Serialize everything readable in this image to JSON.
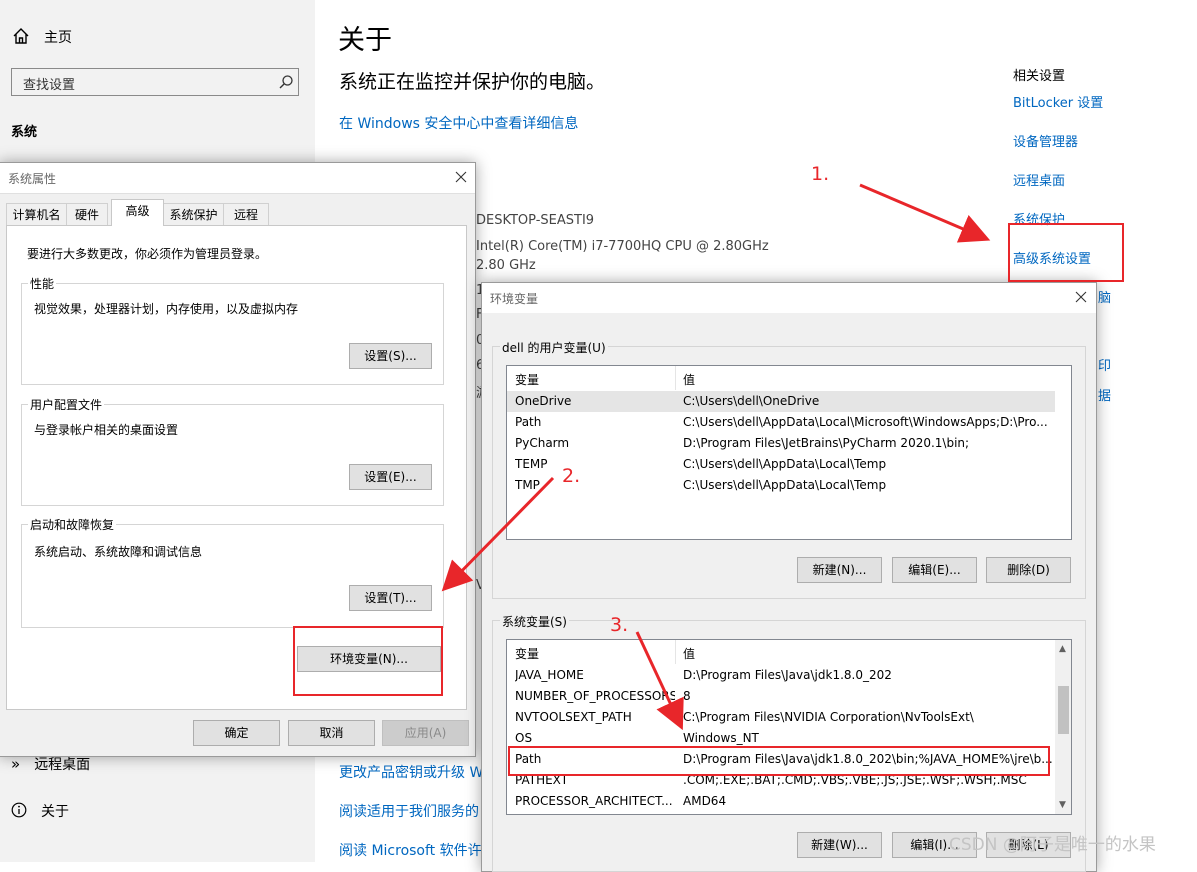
{
  "settings": {
    "nav": {
      "home": "主页",
      "search_placeholder": "查找设置",
      "section": "系统",
      "remote_desktop": "远程桌面",
      "about": "关于"
    },
    "main": {
      "title": "关于",
      "subtitle": "系统正在监控并保护你的电脑。",
      "security_link": "在 Windows 安全中心中查看详细信息",
      "device_name": "DESKTOP-SEASTI9",
      "processor": "Intel(R) Core(TM) i7-7700HQ CPU @ 2.80GHz",
      "processor_speed": "2.80 GHz",
      "partial_chars": [
        "1",
        "F",
        "0",
        "6",
        "游"
      ],
      "partial_v": "V",
      "bottom_links": [
        "更改产品密钥或升级 Wind",
        "阅读适用于我们服务的",
        "阅读 Microsoft 软件许可"
      ]
    },
    "related": {
      "title": "相关设置",
      "links": [
        "BitLocker 设置",
        "设备管理器",
        "远程桌面",
        "系统保护",
        "高级系统设置"
      ],
      "partial_links": [
        "脑",
        "印",
        "据"
      ]
    }
  },
  "system_properties": {
    "title": "系统属性",
    "tabs": [
      "计算机名",
      "硬件",
      "高级",
      "系统保护",
      "远程"
    ],
    "admin_note": "要进行大多数更改，你必须作为管理员登录。",
    "performance": {
      "label": "性能",
      "desc": "视觉效果，处理器计划，内存使用，以及虚拟内存",
      "button": "设置(S)..."
    },
    "user_profiles": {
      "label": "用户配置文件",
      "desc": "与登录帐户相关的桌面设置",
      "button": "设置(E)..."
    },
    "startup": {
      "label": "启动和故障恢复",
      "desc": "系统启动、系统故障和调试信息",
      "button": "设置(T)..."
    },
    "env_button": "环境变量(N)...",
    "ok": "确定",
    "cancel": "取消",
    "apply": "应用(A)"
  },
  "env_vars": {
    "title": "环境变量",
    "user_group": "dell 的用户变量(U)",
    "col_var": "变量",
    "col_val": "值",
    "user_rows": [
      {
        "name": "OneDrive",
        "value": "C:\\Users\\dell\\OneDrive"
      },
      {
        "name": "Path",
        "value": "C:\\Users\\dell\\AppData\\Local\\Microsoft\\WindowsApps;D:\\Pro..."
      },
      {
        "name": "PyCharm",
        "value": "D:\\Program Files\\JetBrains\\PyCharm 2020.1\\bin;"
      },
      {
        "name": "TEMP",
        "value": "C:\\Users\\dell\\AppData\\Local\\Temp"
      },
      {
        "name": "TMP",
        "value": "C:\\Users\\dell\\AppData\\Local\\Temp"
      }
    ],
    "user_buttons": [
      "新建(N)...",
      "编辑(E)...",
      "删除(D)"
    ],
    "sys_group": "系统变量(S)",
    "sys_rows": [
      {
        "name": "JAVA_HOME",
        "value": "D:\\Program Files\\Java\\jdk1.8.0_202"
      },
      {
        "name": "NUMBER_OF_PROCESSORS",
        "value": "8"
      },
      {
        "name": "NVTOOLSEXT_PATH",
        "value": "C:\\Program Files\\NVIDIA Corporation\\NvToolsExt\\"
      },
      {
        "name": "OS",
        "value": "Windows_NT"
      },
      {
        "name": "Path",
        "value": "D:\\Program Files\\Java\\jdk1.8.0_202\\bin;%JAVA_HOME%\\jre\\b..."
      },
      {
        "name": "PATHEXT",
        "value": ".COM;.EXE;.BAT;.CMD;.VBS;.VBE;.JS;.JSE;.WSF;.WSH;.MSC"
      },
      {
        "name": "PROCESSOR_ARCHITECT...",
        "value": "AMD64"
      }
    ],
    "sys_buttons": [
      "新建(W)...",
      "编辑(I)...",
      "删除(L)"
    ]
  },
  "annotations": {
    "step1": "1.",
    "step2": "2.",
    "step3": "3.",
    "color": "#e8262a"
  },
  "watermark": "CSDN @阿子是唯一的水果",
  "colors": {
    "link": "#0067c0",
    "left_pane": "#f2f2f2",
    "dialog": "#f0f0f0"
  }
}
